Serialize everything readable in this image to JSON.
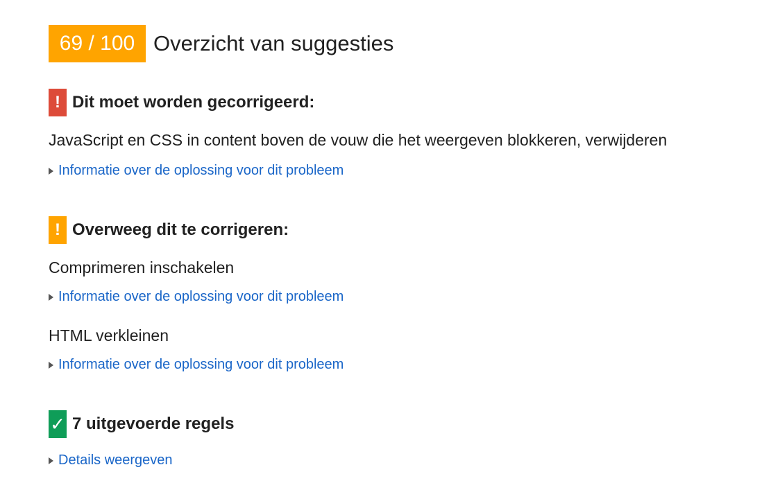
{
  "header": {
    "score": "69 / 100",
    "title": "Overzicht van suggesties"
  },
  "sections": [
    {
      "severity": "red",
      "icon": "exclamation-icon",
      "title": "Dit moet worden gecorrigeerd:",
      "rules": [
        {
          "label": "JavaScript en CSS in content boven de vouw die het weergeven blokkeren, verwijderen",
          "link": "Informatie over de oplossing voor dit probleem"
        }
      ]
    },
    {
      "severity": "orange",
      "icon": "exclamation-icon",
      "title": "Overweeg dit te corrigeren:",
      "rules": [
        {
          "label": "Comprimeren inschakelen",
          "link": "Informatie over de oplossing voor dit probleem"
        },
        {
          "label": "HTML verkleinen",
          "link": "Informatie over de oplossing voor dit probleem"
        }
      ]
    },
    {
      "severity": "green",
      "icon": "checkmark-icon",
      "title": "7 uitgevoerde regels",
      "link": "Details weergeven"
    }
  ],
  "icons": {
    "exclamation": "!",
    "checkmark": "✓"
  },
  "colors": {
    "score_bg": "#ffa400",
    "red": "#dd4b39",
    "orange": "#ffa400",
    "green": "#0f9d58",
    "link": "#1a66c8"
  }
}
